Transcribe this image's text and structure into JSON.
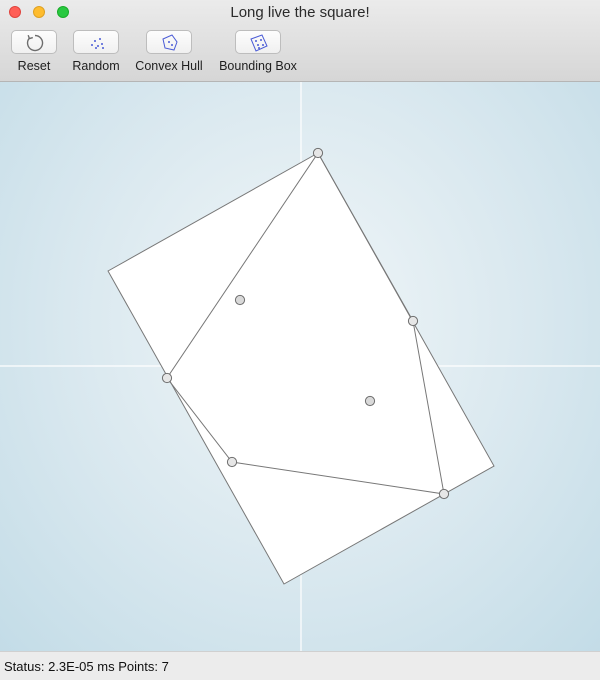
{
  "window": {
    "title": "Long live the square!"
  },
  "toolbar": {
    "reset_label": "Reset",
    "random_label": "Random",
    "convex_hull_label": "Convex Hull",
    "bounding_box_label": "Bounding Box"
  },
  "status": {
    "label": "Status:",
    "time_value": "2.3E-05 ms",
    "points_label": "Points:",
    "points_count": "7"
  },
  "icons": {
    "reset": "reset-icon",
    "random": "random-points-icon",
    "convex_hull": "convex-hull-icon",
    "bounding_box": "bounding-box-icon"
  },
  "colors": {
    "canvas_center": "#f1f6f8",
    "canvas_edge": "#c3dce7",
    "shape_fill": "#ffffff",
    "shape_stroke": "#777777",
    "axis": "#ffffff",
    "point_fill": "#d9d9d9",
    "point_stroke": "#6e6e6e"
  }
}
